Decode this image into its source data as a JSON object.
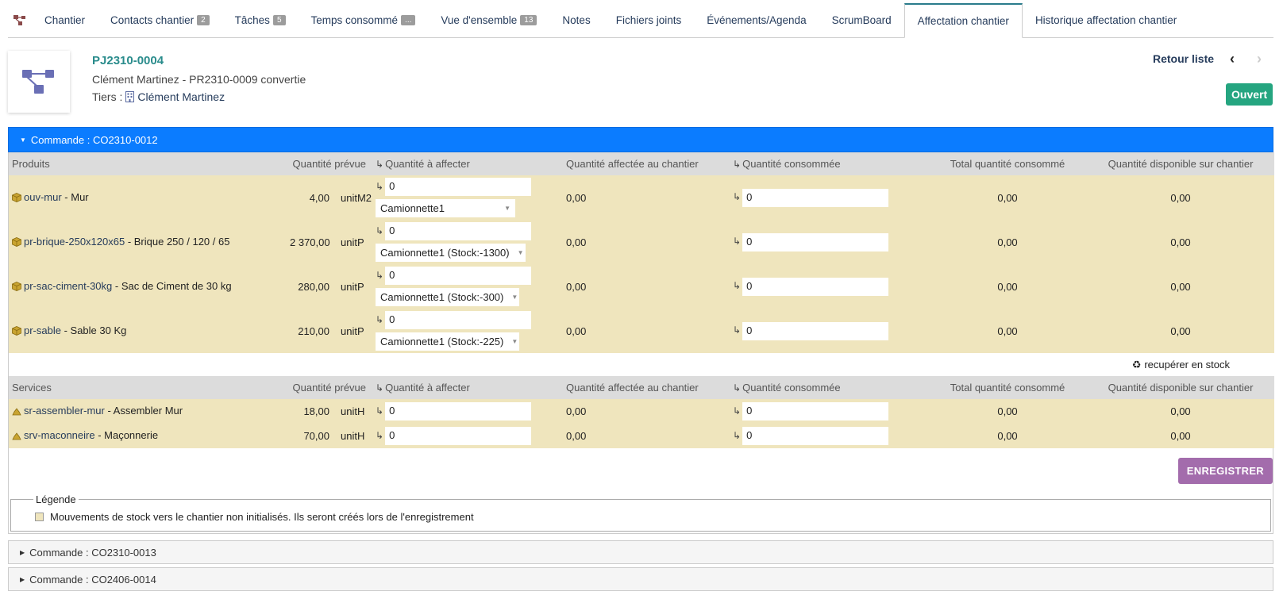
{
  "tabs": [
    {
      "label": "Chantier",
      "badge": ""
    },
    {
      "label": "Contacts chantier",
      "badge": "2"
    },
    {
      "label": "Tâches",
      "badge": "5"
    },
    {
      "label": "Temps consommé",
      "badge": "..."
    },
    {
      "label": "Vue d'ensemble",
      "badge": "13"
    },
    {
      "label": "Notes",
      "badge": ""
    },
    {
      "label": "Fichiers joints",
      "badge": ""
    },
    {
      "label": "Événements/Agenda",
      "badge": ""
    },
    {
      "label": "ScrumBoard",
      "badge": ""
    },
    {
      "label": "Affectation chantier",
      "badge": ""
    },
    {
      "label": "Historique affectation chantier",
      "badge": ""
    }
  ],
  "header": {
    "ref": "PJ2310-0004",
    "subtitle": "Clément Martinez - PR2310-0009 convertie",
    "tiers_label": "Tiers :",
    "tiers_name": "Clément Martinez",
    "back_label": "Retour liste",
    "status": "Ouvert",
    "status_color": "#25a580"
  },
  "order": {
    "title": "Commande : CO2310-0012",
    "products_header": {
      "col1": "Produits",
      "col2": "Quantité prévue",
      "col3": "Quantité à affecter",
      "col4": "Quantité affectée au chantier",
      "col5": "Quantité consommée",
      "col6": "Total quantité consommé",
      "col7": "Quantité disponible sur chantier"
    },
    "products": [
      {
        "ref": "ouv-mur",
        "name": " - Mur",
        "qty": "4,00",
        "unit": "unitM2",
        "assign": "0",
        "warehouse": "Camionnette1",
        "assigned": "0,00",
        "consumed": "0",
        "total": "0,00",
        "available": "0,00"
      },
      {
        "ref": "pr-brique-250x120x65",
        "name": " - Brique 250 / 120 / 65",
        "qty": "2 370,00",
        "unit": "unitP",
        "assign": "0",
        "warehouse": "Camionnette1 (Stock:-1300)",
        "assigned": "0,00",
        "consumed": "0",
        "total": "0,00",
        "available": "0,00"
      },
      {
        "ref": "pr-sac-ciment-30kg",
        "name": " - Sac de Ciment de 30 kg",
        "qty": "280,00",
        "unit": "unitP",
        "assign": "0",
        "warehouse": "Camionnette1 (Stock:-300)",
        "assigned": "0,00",
        "consumed": "0",
        "total": "0,00",
        "available": "0,00"
      },
      {
        "ref": "pr-sable",
        "name": " - Sable 30 Kg",
        "qty": "210,00",
        "unit": "unitP",
        "assign": "0",
        "warehouse": "Camionnette1 (Stock:-225)",
        "assigned": "0,00",
        "consumed": "0",
        "total": "0,00",
        "available": "0,00"
      }
    ],
    "recup_label": "recupérer en stock",
    "services_header": {
      "col1": "Services",
      "col2": "Quantité prévue",
      "col3": "Quantité à affecter",
      "col4": "Quantité affectée au chantier",
      "col5": "Quantité consommée",
      "col6": "Total quantité consommé",
      "col7": "Quantité disponible sur chantier"
    },
    "services": [
      {
        "ref": "sr-assembler-mur",
        "name": " - Assembler Mur",
        "qty": "18,00",
        "unit": "unitH",
        "assign": "0",
        "assigned": "0,00",
        "consumed": "0",
        "total": "0,00",
        "available": "0,00"
      },
      {
        "ref": "srv-maconneire",
        "name": " - Maçonnerie",
        "qty": "70,00",
        "unit": "unitH",
        "assign": "0",
        "assigned": "0,00",
        "consumed": "0",
        "total": "0,00",
        "available": "0,00"
      }
    ],
    "save_label": "ENREGISTRER",
    "legend_title": "Légende",
    "legend_text": "Mouvements de stock vers le chantier non initialisés. Ils seront créés lors de l'enregistrement"
  },
  "collapsed_orders": [
    "Commande : CO2310-0013",
    "Commande : CO2406-0014"
  ],
  "colors": {
    "accent": "#0b7cff",
    "row_bg": "#efe5bd",
    "save": "#a36cac"
  }
}
